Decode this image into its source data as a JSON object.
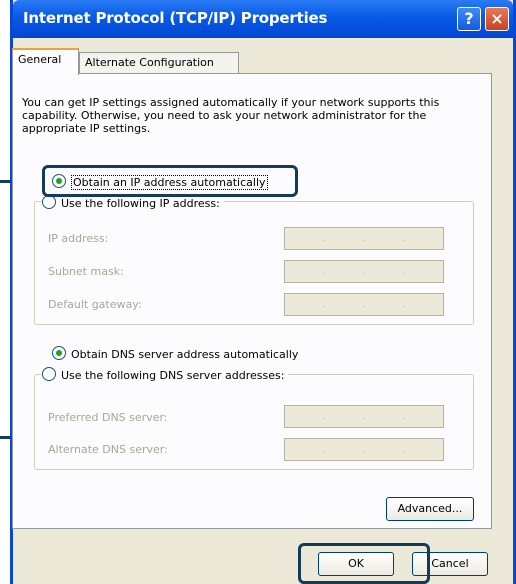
{
  "window": {
    "title": "Internet Protocol (TCP/IP) Properties",
    "help_button": "?",
    "close_button": "×"
  },
  "tabs": [
    {
      "label": "General",
      "active": true
    },
    {
      "label": "Alternate Configuration",
      "active": false
    }
  ],
  "description": "You can get IP settings assigned automatically if your network supports this capability. Otherwise, you need to ask your network administrator for the appropriate IP settings.",
  "ip_section": {
    "auto_label": "Obtain an IP address automatically",
    "manual_label": "Use the following IP address:",
    "selected": "auto",
    "fields": [
      {
        "label": "IP address:"
      },
      {
        "label": "Subnet mask:"
      },
      {
        "label": "Default gateway:"
      }
    ]
  },
  "dns_section": {
    "auto_label": "Obtain DNS server address automatically",
    "manual_label": "Use the following DNS server addresses:",
    "selected": "auto",
    "fields": [
      {
        "label": "Preferred DNS server:"
      },
      {
        "label": "Alternate DNS server:"
      }
    ]
  },
  "buttons": {
    "advanced": "Advanced...",
    "ok": "OK",
    "cancel": "Cancel"
  },
  "colors": {
    "titlebar": "#0a5ce6",
    "highlight": "#133b5c",
    "dialog_bg": "#ece9d8"
  }
}
